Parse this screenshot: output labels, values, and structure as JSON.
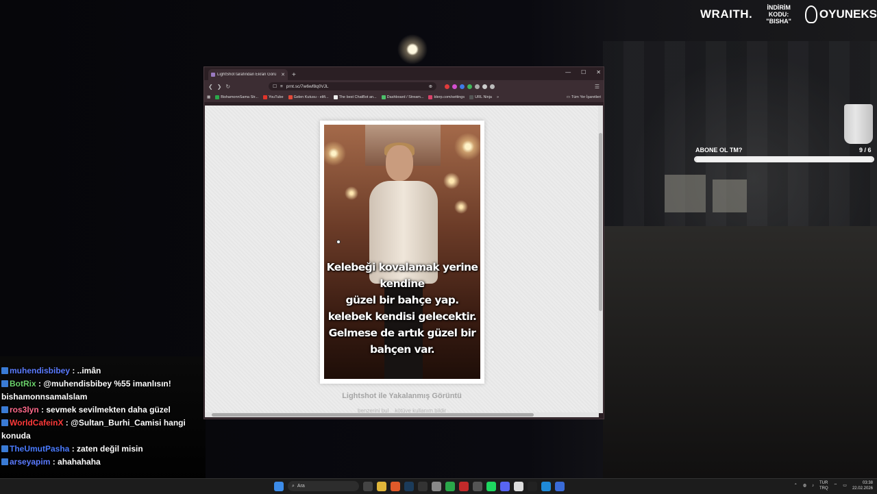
{
  "overlay": {
    "sponsor_brand": "WRAITH.",
    "sponsor_code_line1": "İNDİRİM KODU:",
    "sponsor_code_line2": "\"BISHA\"",
    "sponsor_logo_text": "OYUNEKS",
    "goal_label": "ABONE OL TM?",
    "goal_count": "9 / 6",
    "goal_progress": 1.0
  },
  "browser": {
    "tab_title": "LightShot tarafından Ekran Görü",
    "url": "prnt.sc/7w6wf8q0VJL",
    "bookmarks": [
      {
        "label": "BishamonnSama Str...",
        "color": "#2aa84a"
      },
      {
        "label": "YouTube",
        "color": "#e0342a"
      },
      {
        "label": "Gelen Kutusu - elifi...",
        "color": "#e24a3a"
      },
      {
        "label": "The best ChatBot an...",
        "color": "#eeeeee"
      },
      {
        "label": "Dashboard / Stream...",
        "color": "#4cbf6a"
      },
      {
        "label": "blerp.com/settings",
        "color": "#d9436a"
      },
      {
        "label": "URL Ninja",
        "color": "#555555"
      }
    ],
    "bookmarks_folder": "Tüm Yer İşaretleri",
    "page": {
      "quote": "Kelebeği kovalamak yerine kendine güzel bir bahçe yap. kelebek kendisi gelecektir. Gelmese de artık güzel bir bahçen var.",
      "quote_lines": [
        "Kelebeği kovalamak yerine kendine",
        "güzel bir bahçe yap.",
        "kelebek kendisi gelecektir.",
        "Gelmese de artık güzel bir",
        "bahçen var."
      ],
      "caption": "Lightshot ile Yakalanmış Görüntü",
      "link1": "benzerini bul",
      "link2": "kötüye kullanım bildir"
    }
  },
  "chat": [
    {
      "user": "muhendisbibey",
      "text": ": ..imân",
      "color": "#5b7bff"
    },
    {
      "user": "BotRix",
      "text": ": @muhendisbibey %55 imanlısın! bishamonnsamalslam",
      "color": "#6bd26b"
    },
    {
      "user": "ros3lyn",
      "text": ": sevmek sevilmekten daha güzel",
      "color": "#ff6a8b"
    },
    {
      "user": "WorldCafeinX",
      "text": ": @Sultan_Burhi_Camisi hangi konuda",
      "color": "#ff3a3a"
    },
    {
      "user": "TheUmutPasha",
      "text": ": zaten değil misin",
      "color": "#4a7bff"
    },
    {
      "user": "arseyapim",
      "text": ": ahahahaha",
      "color": "#5b7bff"
    }
  ],
  "taskbar": {
    "search_placeholder": "Ara",
    "lang_line1": "TUR",
    "lang_line2": "TRQ",
    "time": "03:38",
    "date": "22.02.2026"
  }
}
